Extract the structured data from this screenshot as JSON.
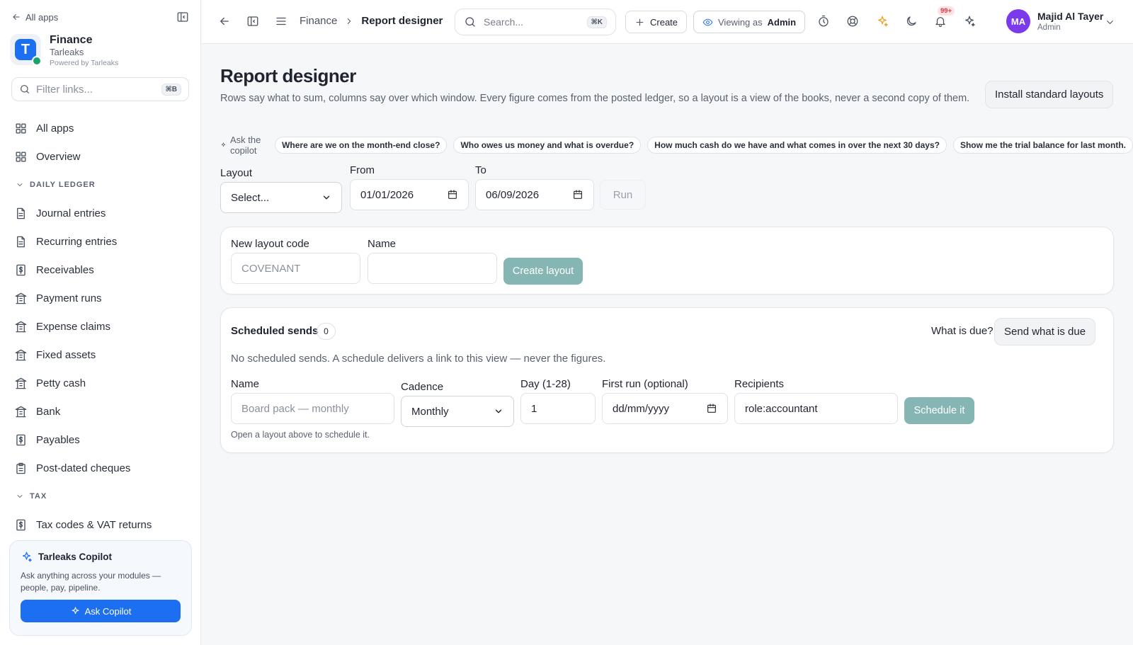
{
  "sidebar": {
    "all_apps_link": "All apps",
    "brand": {
      "name": "Finance",
      "org": "Tarleaks",
      "powered": "Powered by Tarleaks",
      "logo_letter": "T"
    },
    "filter": {
      "placeholder": "Filter links...",
      "shortcut": "⌘B"
    },
    "top_items": [
      {
        "label": "All apps",
        "icon": "grid-icon"
      },
      {
        "label": "Overview",
        "icon": "grid-icon"
      }
    ],
    "sections": [
      {
        "title": "DAILY LEDGER",
        "items": [
          {
            "label": "Journal entries",
            "icon": "document-icon"
          },
          {
            "label": "Recurring entries",
            "icon": "document-icon"
          },
          {
            "label": "Receivables",
            "icon": "dollar-doc-icon"
          },
          {
            "label": "Payment runs",
            "icon": "bank-icon"
          },
          {
            "label": "Expense claims",
            "icon": "bank-icon"
          },
          {
            "label": "Fixed assets",
            "icon": "bank-icon"
          },
          {
            "label": "Petty cash",
            "icon": "bank-icon"
          },
          {
            "label": "Bank",
            "icon": "bank-icon"
          },
          {
            "label": "Payables",
            "icon": "dollar-doc-icon"
          },
          {
            "label": "Post-dated cheques",
            "icon": "clipboard-icon"
          }
        ]
      },
      {
        "title": "TAX",
        "items": [
          {
            "label": "Tax codes & VAT returns",
            "icon": "dollar-doc-icon"
          }
        ]
      }
    ],
    "copilot_card": {
      "title": "Tarleaks Copilot",
      "description": "Ask anything across your modules — people, pay, pipeline.",
      "button": "Ask Copilot"
    }
  },
  "header": {
    "breadcrumb": [
      "Finance",
      "Report designer"
    ],
    "search": {
      "placeholder": "Search...",
      "shortcut": "⌘K"
    },
    "create_label": "Create",
    "viewing_as_label": "Viewing as",
    "viewing_as_value": "Admin",
    "notification_badge": "99+",
    "user": {
      "initials": "MA",
      "name": "Majid Al Tayer",
      "role": "Admin"
    }
  },
  "page": {
    "title": "Report designer",
    "subtitle": "Rows say what to sum, columns say over which window. Every figure comes from the posted ledger, so a layout is a view of the books, never a second copy of them.",
    "install_button": "Install standard layouts",
    "ask_label": "Ask the copilot",
    "suggestions": [
      "Where are we on the month-end close?",
      "Who owes us money and what is overdue?",
      "How much cash do we have and what comes in over the next 30 days?",
      "Show me the trial balance for last month."
    ],
    "filters": {
      "layout_label": "Layout",
      "layout_value": "Select...",
      "from_label": "From",
      "from_value": "01/01/2026",
      "to_label": "To",
      "to_value": "06/09/2026",
      "run_button": "Run"
    },
    "new_layout": {
      "code_label": "New layout code",
      "code_placeholder": "COVENANT",
      "name_label": "Name",
      "name_value": "",
      "create_button": "Create layout"
    },
    "scheduled": {
      "title": "Scheduled sends",
      "count": "0",
      "what_due_button": "What is due?",
      "send_due_button": "Send what is due",
      "empty_text": "No scheduled sends. A schedule delivers a link to this view — never the figures.",
      "name_label": "Name",
      "name_placeholder": "Board pack — monthly",
      "cadence_label": "Cadence",
      "cadence_value": "Monthly",
      "day_label": "Day (1-28)",
      "day_value": "1",
      "first_run_label": "First run (optional)",
      "first_run_placeholder": "dd/mm/yyyy",
      "recipients_label": "Recipients",
      "recipients_value": "role:accountant",
      "schedule_button": "Schedule it",
      "hint": "Open a layout above to schedule it."
    }
  },
  "colors": {
    "accent": "#1d6ff2",
    "teal_button": "#86b6b3",
    "avatar": "#7c3aed",
    "star": "#f0a020"
  }
}
